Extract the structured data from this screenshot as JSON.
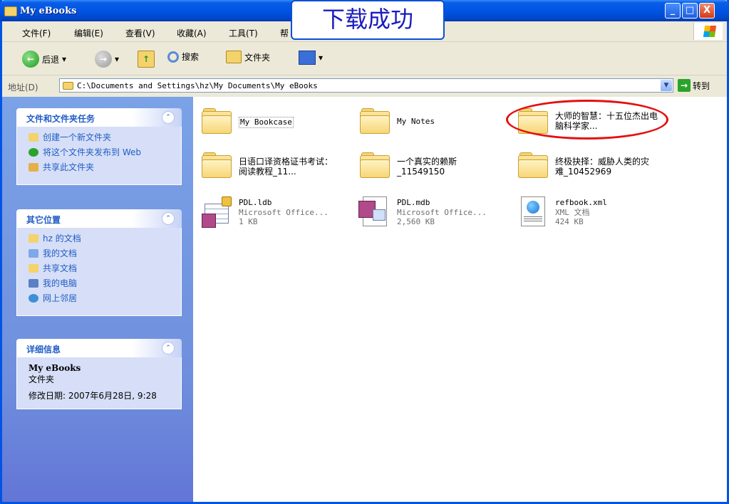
{
  "window": {
    "title": "My eBooks",
    "min": "_",
    "max": "□",
    "close": "X"
  },
  "menu": [
    "文件(F)",
    "编辑(E)",
    "查看(V)",
    "收藏(A)",
    "工具(T)",
    "帮"
  ],
  "toolbar": {
    "back": "后退",
    "search": "搜索",
    "folders": "文件夹"
  },
  "address": {
    "label": "地址(D)",
    "path": "C:\\Documents and Settings\\hz\\My Documents\\My eBooks",
    "go": "转到"
  },
  "overlay": {
    "text": "下载成功"
  },
  "tasks": {
    "title": "文件和文件夹任务",
    "items": [
      "创建一个新文件夹",
      "将这个文件夹发布到 Web",
      "共享此文件夹"
    ]
  },
  "places": {
    "title": "其它位置",
    "items": [
      "hz 的文档",
      "我的文档",
      "共享文档",
      "我的电脑",
      "网上邻居"
    ]
  },
  "details": {
    "title": "详细信息",
    "name": "My eBooks",
    "type": "文件夹",
    "modified": "修改日期: 2007年6月28日, 9:28"
  },
  "files": [
    {
      "name": "My Bookcase",
      "sub1": "",
      "sub2": "",
      "icon": "folder"
    },
    {
      "name": "My Notes",
      "sub1": "",
      "sub2": "",
      "icon": "folder"
    },
    {
      "name": "大师的智慧：十五位杰出电脑科学家...",
      "sub1": "",
      "sub2": "",
      "icon": "folder"
    },
    {
      "name": "日语口译资格证书考试：阅读教程_11...",
      "sub1": "",
      "sub2": "",
      "icon": "folder"
    },
    {
      "name": "一个真实的赖斯_11549150",
      "sub1": "",
      "sub2": "",
      "icon": "folder"
    },
    {
      "name": "终极抉择：威胁人类的灾难_10452969",
      "sub1": "",
      "sub2": "",
      "icon": "folder"
    },
    {
      "name": "PDL.ldb",
      "sub1": "Microsoft Office...",
      "sub2": "1 KB",
      "icon": "ldb"
    },
    {
      "name": "PDL.mdb",
      "sub1": "Microsoft Office...",
      "sub2": "2,560 KB",
      "icon": "mdb"
    },
    {
      "name": "refbook.xml",
      "sub1": "XML 文档",
      "sub2": "424 KB",
      "icon": "xml"
    }
  ],
  "colors": {
    "titlebar": "#0054e3",
    "link": "#215dc6",
    "highlight": "#e51010",
    "overlay_text": "#1b1bbf"
  }
}
